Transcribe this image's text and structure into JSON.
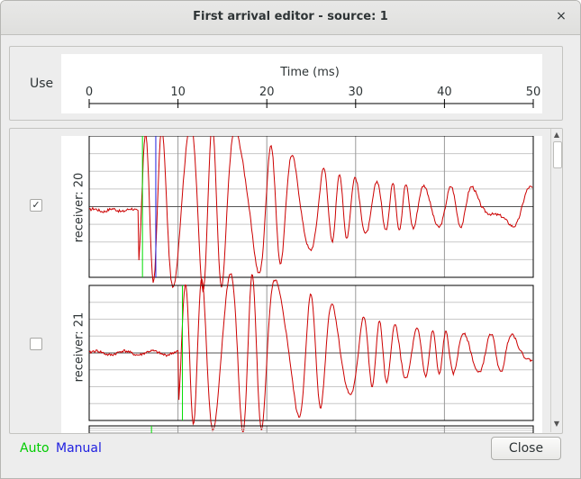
{
  "window": {
    "title": "First arrival editor - source: 1",
    "close_glyph": "×"
  },
  "header": {
    "use_label": "Use",
    "axis_title": "Time (ms)",
    "ticks": [
      "0",
      "10",
      "20",
      "30",
      "40",
      "50"
    ]
  },
  "traces": [
    {
      "label": "receiver: 20",
      "use_checked": true,
      "check_glyph": "✓",
      "auto_ms": 6,
      "manual_ms": 7.5
    },
    {
      "label": "receiver: 21",
      "use_checked": false,
      "check_glyph": "",
      "auto_ms": 10.5,
      "manual_ms": 10.5
    }
  ],
  "legend": {
    "auto": "Auto",
    "manual": "Manual"
  },
  "buttons": {
    "close": "Close"
  },
  "colors": {
    "auto": "#00dd00",
    "manual": "#2020e0",
    "trace": "#cc0000",
    "grid": "#c8c8c8",
    "panel_border": "#000000"
  },
  "time_axis": {
    "min_ms": 0,
    "max_ms": 50
  }
}
